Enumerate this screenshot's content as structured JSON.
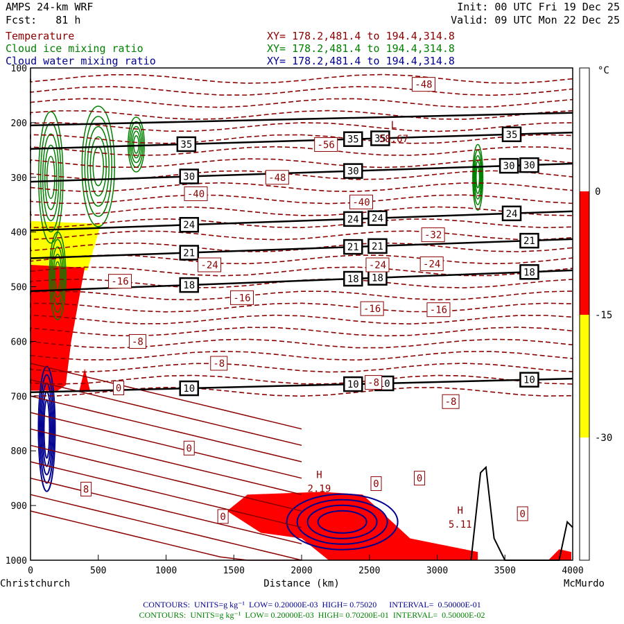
{
  "header": {
    "model": "AMPS 24-km WRF",
    "fcst": "Fcst:   81 h",
    "init": "Init: 00 UTC Fri 19 Dec 25",
    "valid": "Valid: 09 UTC Mon 22 Dec 25"
  },
  "fields": [
    {
      "name": "Temperature",
      "xy": "XY= 178.2,481.4 to 194.4,314.8",
      "color": "#8b0000"
    },
    {
      "name": "Cloud ice mixing ratio",
      "xy": "XY= 178.2,481.4 to 194.4,314.8",
      "color": "#008000"
    },
    {
      "name": "Cloud water mixing ratio",
      "xy": "XY= 178.2,481.4 to 194.4,314.8",
      "color": "#000090"
    }
  ],
  "footer": {
    "water": "CONTOURS:  UNITS=g kg⁻¹  LOW= 0.20000E-03  HIGH= 0.75020      INTERVAL=  0.50000E-01",
    "ice": "CONTOURS:  UNITS=g kg⁻¹  LOW= 0.20000E-03  HIGH= 0.70200E-01  INTERVAL=  0.50000E-02"
  },
  "chart_data": {
    "type": "line",
    "title": "AMPS 24-km WRF cross-section",
    "xlabel": "Distance (km)",
    "xlim": [
      0,
      4000
    ],
    "ylim": [
      1000,
      100
    ],
    "x_ticks": [
      0,
      500,
      1000,
      1500,
      2000,
      2500,
      3000,
      3500,
      4000
    ],
    "y_ticks": [
      100,
      200,
      300,
      400,
      500,
      600,
      700,
      800,
      900,
      1000
    ],
    "start_label": "Christchurch",
    "end_label": "McMurdo",
    "colorbar": {
      "unit": "°C",
      "ticks": [
        "0",
        "-15",
        "-30"
      ],
      "bands": [
        {
          "from": 0,
          "to": -15,
          "color": "#ff0000"
        },
        {
          "from": -15,
          "to": -30,
          "color": "#ffff00"
        }
      ]
    },
    "theta_lines": [
      {
        "label": "",
        "p_left": 205,
        "p_right": 182,
        "label_x": []
      },
      {
        "label": "35",
        "p_left": 248,
        "p_right": 218,
        "label_x": [
          1150,
          2380,
          2580,
          3550
        ]
      },
      {
        "label": "30",
        "p_left": 308,
        "p_right": 275,
        "label_x": [
          1170,
          2380,
          3530,
          3680
        ]
      },
      {
        "label": "24",
        "p_left": 397,
        "p_right": 362,
        "label_x": [
          1170,
          2380,
          2560,
          3550
        ]
      },
      {
        "label": "21",
        "p_left": 448,
        "p_right": 413,
        "label_x": [
          1170,
          2380,
          2560,
          3680
        ]
      },
      {
        "label": "18",
        "p_left": 508,
        "p_right": 470,
        "label_x": [
          1170,
          2380,
          2560,
          3680
        ]
      },
      {
        "label": "10",
        "p_left": 693,
        "p_right": 668,
        "label_x": [
          1170,
          2380,
          2610,
          3680
        ]
      }
    ],
    "temperature_labels": [
      {
        "text": "-48",
        "x": 2900,
        "p": 130
      },
      {
        "text": "-56",
        "x": 2180,
        "p": 240
      },
      {
        "text": "-48",
        "x": 1820,
        "p": 300
      },
      {
        "text": "-40",
        "x": 1220,
        "p": 330
      },
      {
        "text": "-40",
        "x": 2440,
        "p": 345
      },
      {
        "text": "-32",
        "x": 2970,
        "p": 405
      },
      {
        "text": "-24",
        "x": 1320,
        "p": 460
      },
      {
        "text": "-24",
        "x": 2560,
        "p": 460
      },
      {
        "text": "-24",
        "x": 2960,
        "p": 458
      },
      {
        "text": "-16",
        "x": 660,
        "p": 490
      },
      {
        "text": "-16",
        "x": 1560,
        "p": 520
      },
      {
        "text": "-16",
        "x": 2520,
        "p": 540
      },
      {
        "text": "-16",
        "x": 3010,
        "p": 542
      },
      {
        "text": "-8",
        "x": 790,
        "p": 600
      },
      {
        "text": "-8",
        "x": 1390,
        "p": 640
      },
      {
        "text": "-8",
        "x": 2530,
        "p": 675
      },
      {
        "text": "-8",
        "x": 3100,
        "p": 710
      },
      {
        "text": "0",
        "x": 650,
        "p": 685
      },
      {
        "text": "0",
        "x": 1170,
        "p": 795
      },
      {
        "text": "0",
        "x": 2550,
        "p": 860
      },
      {
        "text": "0",
        "x": 2870,
        "p": 850
      },
      {
        "text": "0",
        "x": 3630,
        "p": 915
      },
      {
        "text": "0",
        "x": 1420,
        "p": 920
      },
      {
        "text": "8",
        "x": 410,
        "p": 870
      }
    ],
    "extrema": [
      {
        "text": "L",
        "x": 2680,
        "p": 210,
        "value": "58.67"
      },
      {
        "text": "H",
        "x": 2130,
        "p": 850,
        "value": "2.19"
      },
      {
        "text": "H",
        "x": 3170,
        "p": 915,
        "value": "5.11"
      }
    ]
  }
}
